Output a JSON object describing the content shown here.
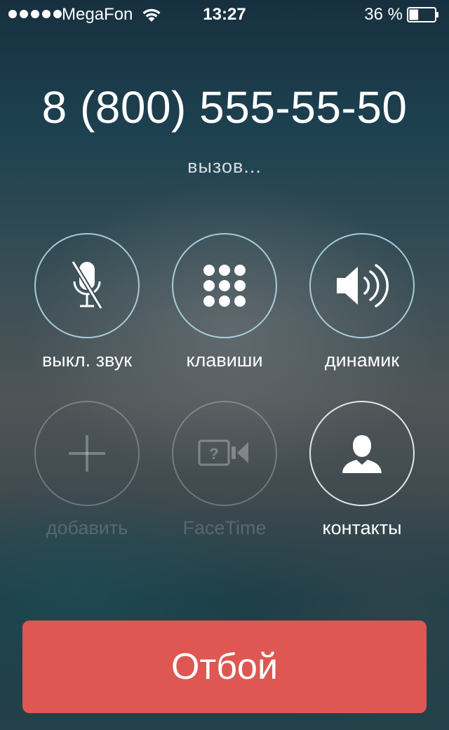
{
  "status_bar": {
    "carrier": "MegaFon",
    "time": "13:27",
    "battery_percent": "36 %",
    "signal_bars": 5,
    "battery_level": 0.36,
    "icons": [
      "signal-dots-icon",
      "wifi-icon",
      "battery-icon"
    ]
  },
  "call": {
    "number": "8 (800) 555-55-50",
    "status": "вызов..."
  },
  "buttons": [
    {
      "label": "выкл. звук",
      "icon": "mute-microphone-icon",
      "enabled": true
    },
    {
      "label": "клавиши",
      "icon": "keypad-icon",
      "enabled": true
    },
    {
      "label": "динамик",
      "icon": "speaker-icon",
      "enabled": true
    },
    {
      "label": "добавить",
      "icon": "plus-icon",
      "enabled": false
    },
    {
      "label": "FaceTime",
      "icon": "facetime-icon",
      "enabled": false
    },
    {
      "label": "контакты",
      "icon": "contact-person-icon",
      "enabled": true
    }
  ],
  "end_call": {
    "label": "Отбой",
    "color": "#de5752"
  }
}
